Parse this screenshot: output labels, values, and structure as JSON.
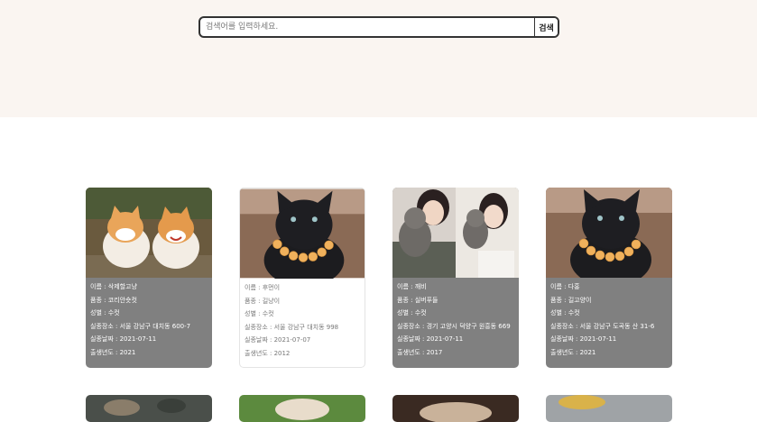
{
  "search": {
    "placeholder": "검색어를 입력하세요.",
    "button_label": "검색"
  },
  "cards": [
    {
      "photo": "two-orange-cats",
      "theme": "dark",
      "lines": [
        "이름 : 삭제할고냥",
        "품종 : 코리안숏컷",
        "성별 : 수컷",
        "실종장소 : 서울 강남구 대치동 600-7",
        "실종날짜 : 2021-07-11",
        "출생년도 : 2021"
      ]
    },
    {
      "photo": "black-cat-collar",
      "theme": "light",
      "lines": [
        "이름 : 후먼이",
        "품종 : 길냥이",
        "성별 : 수컷",
        "실종장소 : 서울 강남구 대치동 998",
        "실종날짜 : 2021-07-07",
        "출생년도 : 2012"
      ]
    },
    {
      "photo": "woman-with-poodles",
      "theme": "dark",
      "lines": [
        "이름 : 깨비",
        "품종 : 실버푸들",
        "성별 : 수컷",
        "실종장소 : 경기 고양시 덕양구 원흥동 669",
        "실종날짜 : 2021-07-11",
        "출생년도 : 2017"
      ]
    },
    {
      "photo": "black-cat-collar",
      "theme": "dark",
      "lines": [
        "이름 : 다홍",
        "품종 : 길고양이",
        "성별 : 수컷",
        "실종장소 : 서울 강남구 도곡동 산 31-6",
        "실종날짜 : 2021-07-11",
        "출생년도 : 2021"
      ]
    }
  ],
  "colors": {
    "hero_bg": "#faf5f1",
    "card_dark": "#808080"
  }
}
